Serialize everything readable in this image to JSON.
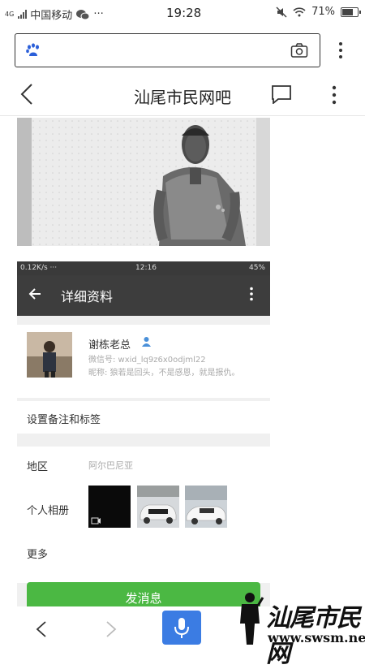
{
  "status": {
    "carrier": "中国移动",
    "signal_label": "4G",
    "time": "19:28",
    "battery": "71%"
  },
  "browser": {
    "url_placeholder": ""
  },
  "header": {
    "title": "汕尾市民网吧"
  },
  "embedded": {
    "status_left": "0.12K/s ···",
    "status_time": "12:16",
    "status_battery": "45%",
    "page_title": "详细资料",
    "profile_name": "谢栋老总",
    "wechat_id": "微信号: wxid_lq9z6x0odjml22",
    "nickname_line": "昵称: 狼若是回头，不是感恩，就是报仇。",
    "set_remark": "设置备注和标签",
    "region_label": "地区",
    "region_value": "阿尔巴尼亚",
    "album_label": "个人相册",
    "more_label": "更多",
    "send_button": "发消息"
  },
  "watermark": {
    "text": "汕尾市民网",
    "url": "www.swsm.net"
  },
  "colors": {
    "accent_blue": "#3b7ce3",
    "wechat_green": "#4bb843",
    "dark_header": "#3d3d3d"
  }
}
